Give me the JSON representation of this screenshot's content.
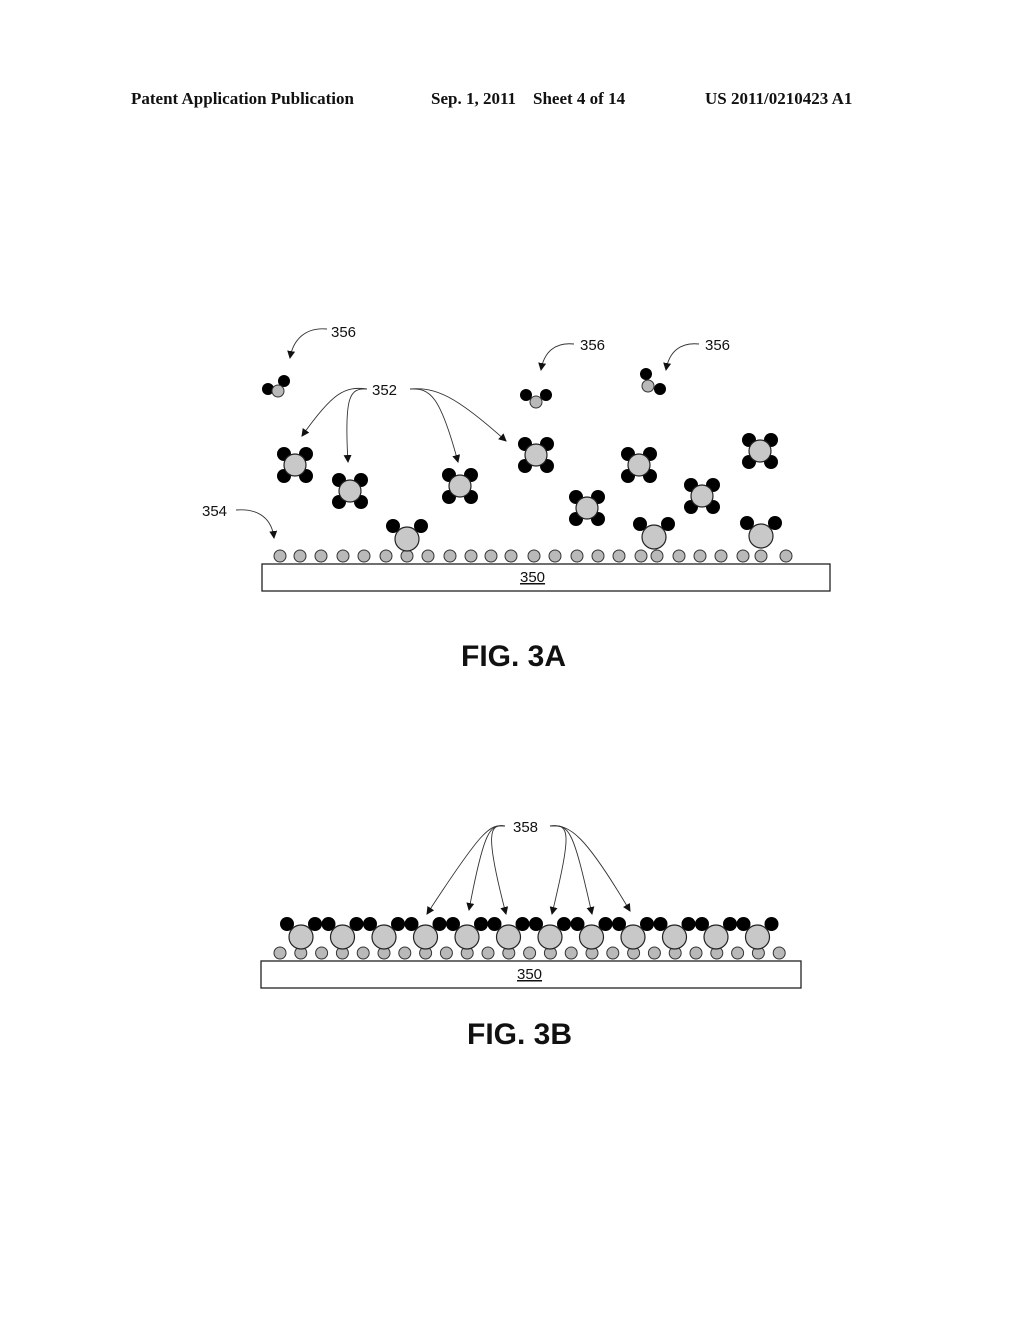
{
  "header": {
    "left": "Patent Application Publication",
    "date_sheet": "Sep. 1, 2011    Sheet 4 of 14",
    "pub_number": "US 2011/0210423 A1"
  },
  "fig3a": {
    "caption": "FIG. 3A",
    "substrate_label": "350",
    "labels": {
      "free_ligand_1": "356",
      "free_ligand_2": "356",
      "free_ligand_3": "356",
      "precursor": "352",
      "surface_layer": "354"
    }
  },
  "fig3b": {
    "caption": "FIG. 3B",
    "substrate_label": "350",
    "labels": {
      "bound_molecules": "358"
    }
  }
}
